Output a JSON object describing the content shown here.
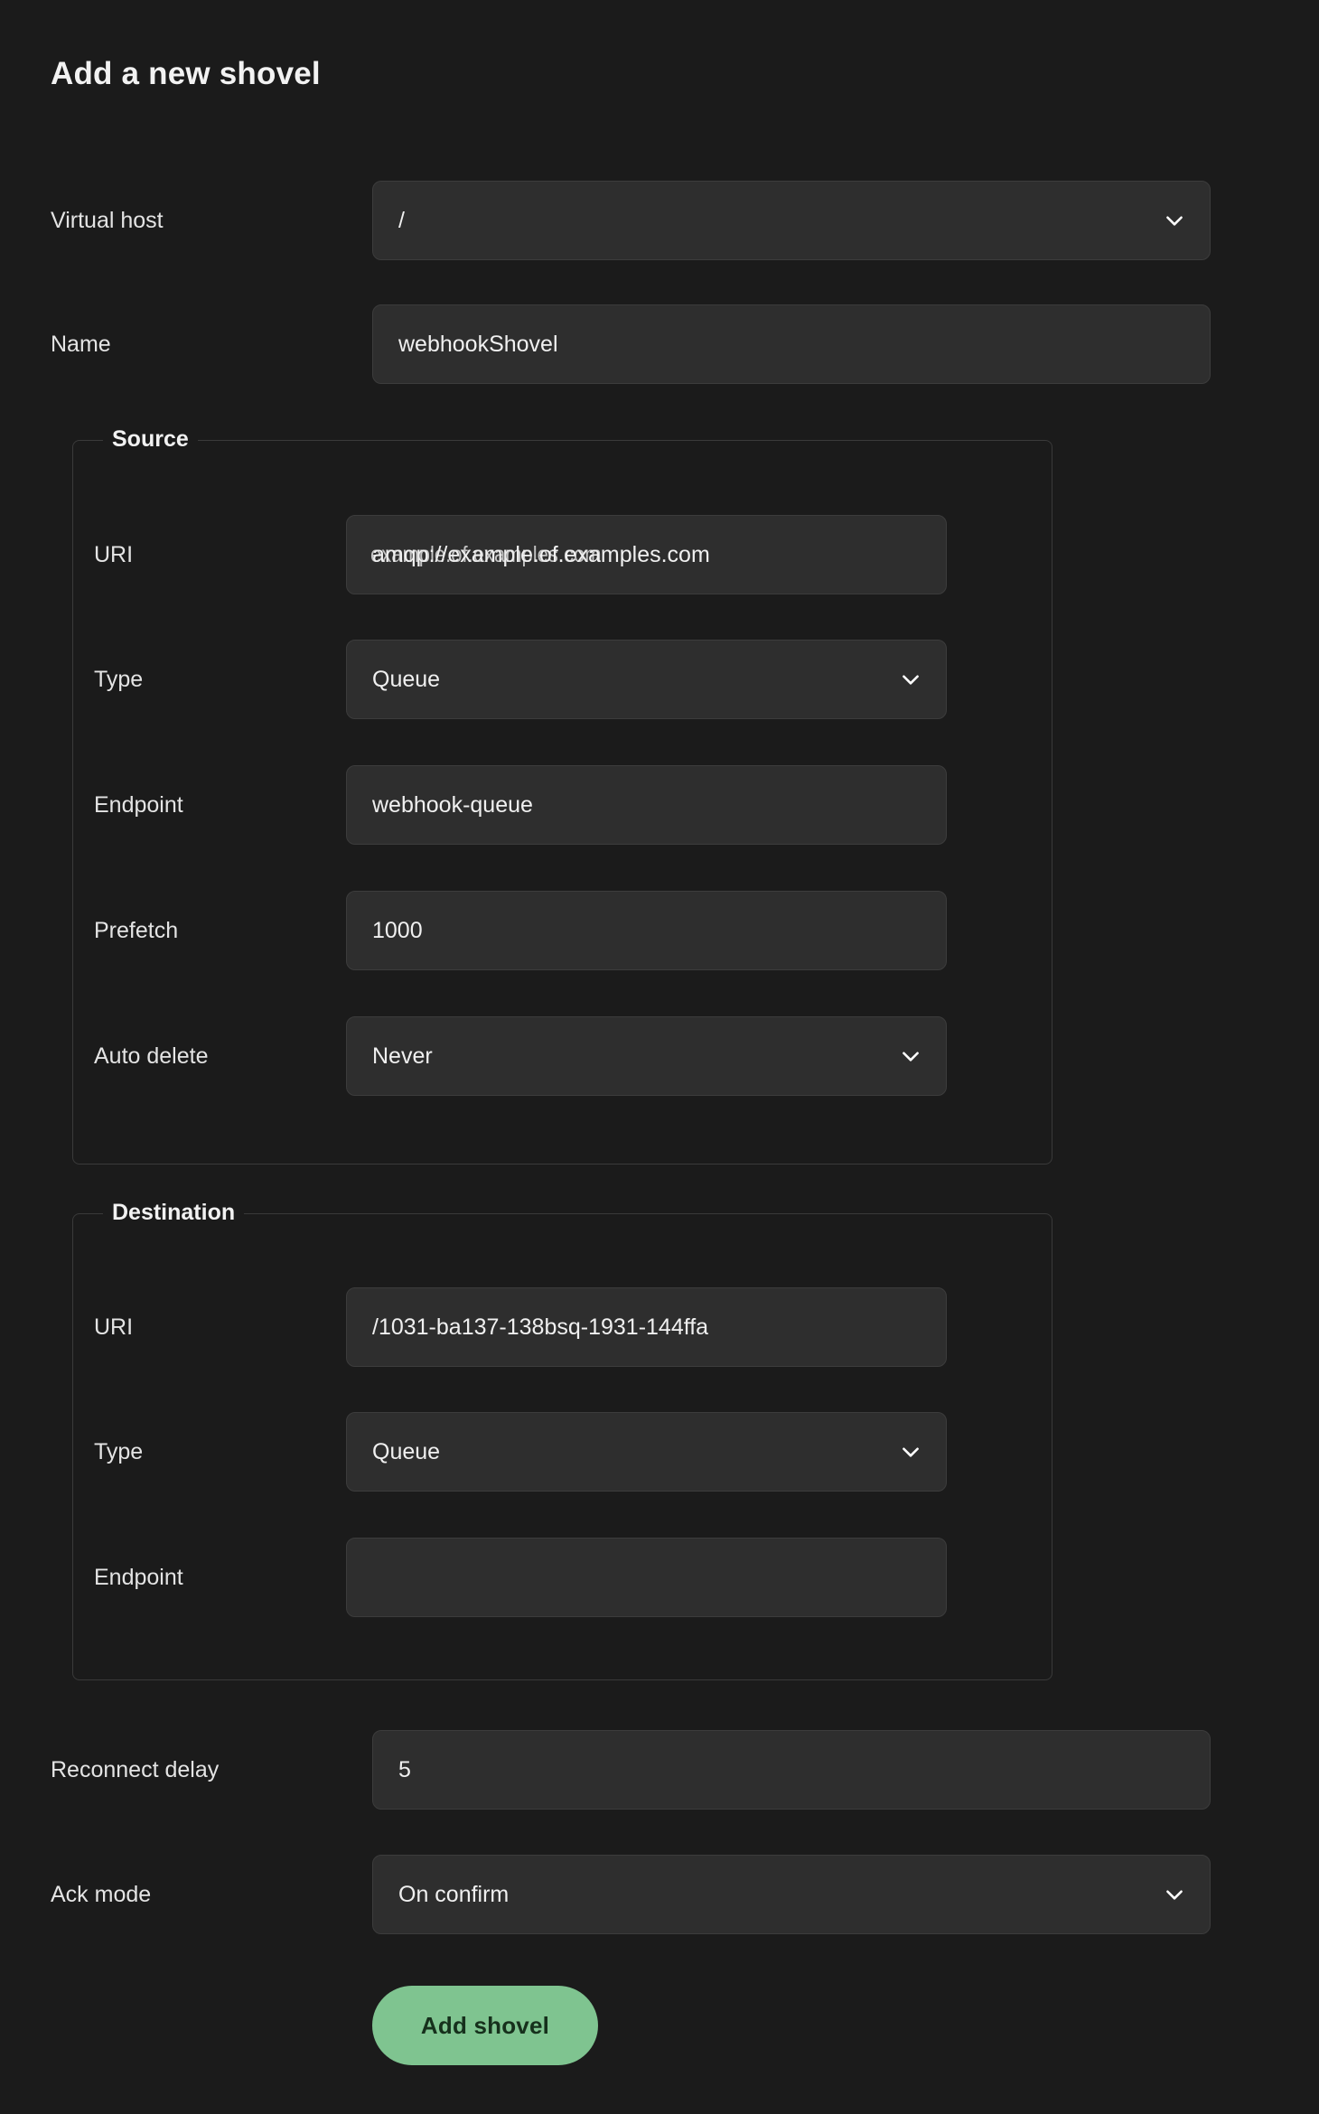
{
  "page": {
    "title": "Add a new shovel",
    "background": "#1b1b1b",
    "accent": "#7fc490"
  },
  "form": {
    "virtual_host": {
      "label": "Virtual host",
      "value": "/",
      "control": "select",
      "icon": "chevron-down-icon"
    },
    "name": {
      "label": "Name",
      "value": "webhookShovel",
      "control": "text"
    },
    "source": {
      "legend": "Source",
      "uri": {
        "label": "URI",
        "value": "amqp://example.of.examples.com",
        "overlap_value": "example.of.examples.com",
        "prefix": "amqp://",
        "control": "text"
      },
      "type": {
        "label": "Type",
        "value": "Queue",
        "control": "select",
        "icon": "chevron-down-icon"
      },
      "endpoint": {
        "label": "Endpoint",
        "value": "webhook-queue",
        "control": "text"
      },
      "prefetch": {
        "label": "Prefetch",
        "value": "1000",
        "control": "text"
      },
      "auto_delete": {
        "label": "Auto delete",
        "value": "Never",
        "control": "select",
        "icon": "chevron-down-icon"
      }
    },
    "destination": {
      "legend": "Destination",
      "uri": {
        "label": "URI",
        "value": "/1031-ba137-138bsq-1931-144ffa",
        "control": "text"
      },
      "type": {
        "label": "Type",
        "value": "Queue",
        "control": "select",
        "icon": "chevron-down-icon"
      },
      "endpoint": {
        "label": "Endpoint",
        "value": "",
        "control": "text"
      }
    },
    "reconnect_delay": {
      "label": "Reconnect delay",
      "value": "5",
      "control": "text"
    },
    "ack_mode": {
      "label": "Ack mode",
      "value": "On confirm",
      "control": "select",
      "icon": "chevron-down-icon"
    },
    "submit": {
      "label": "Add shovel"
    }
  }
}
